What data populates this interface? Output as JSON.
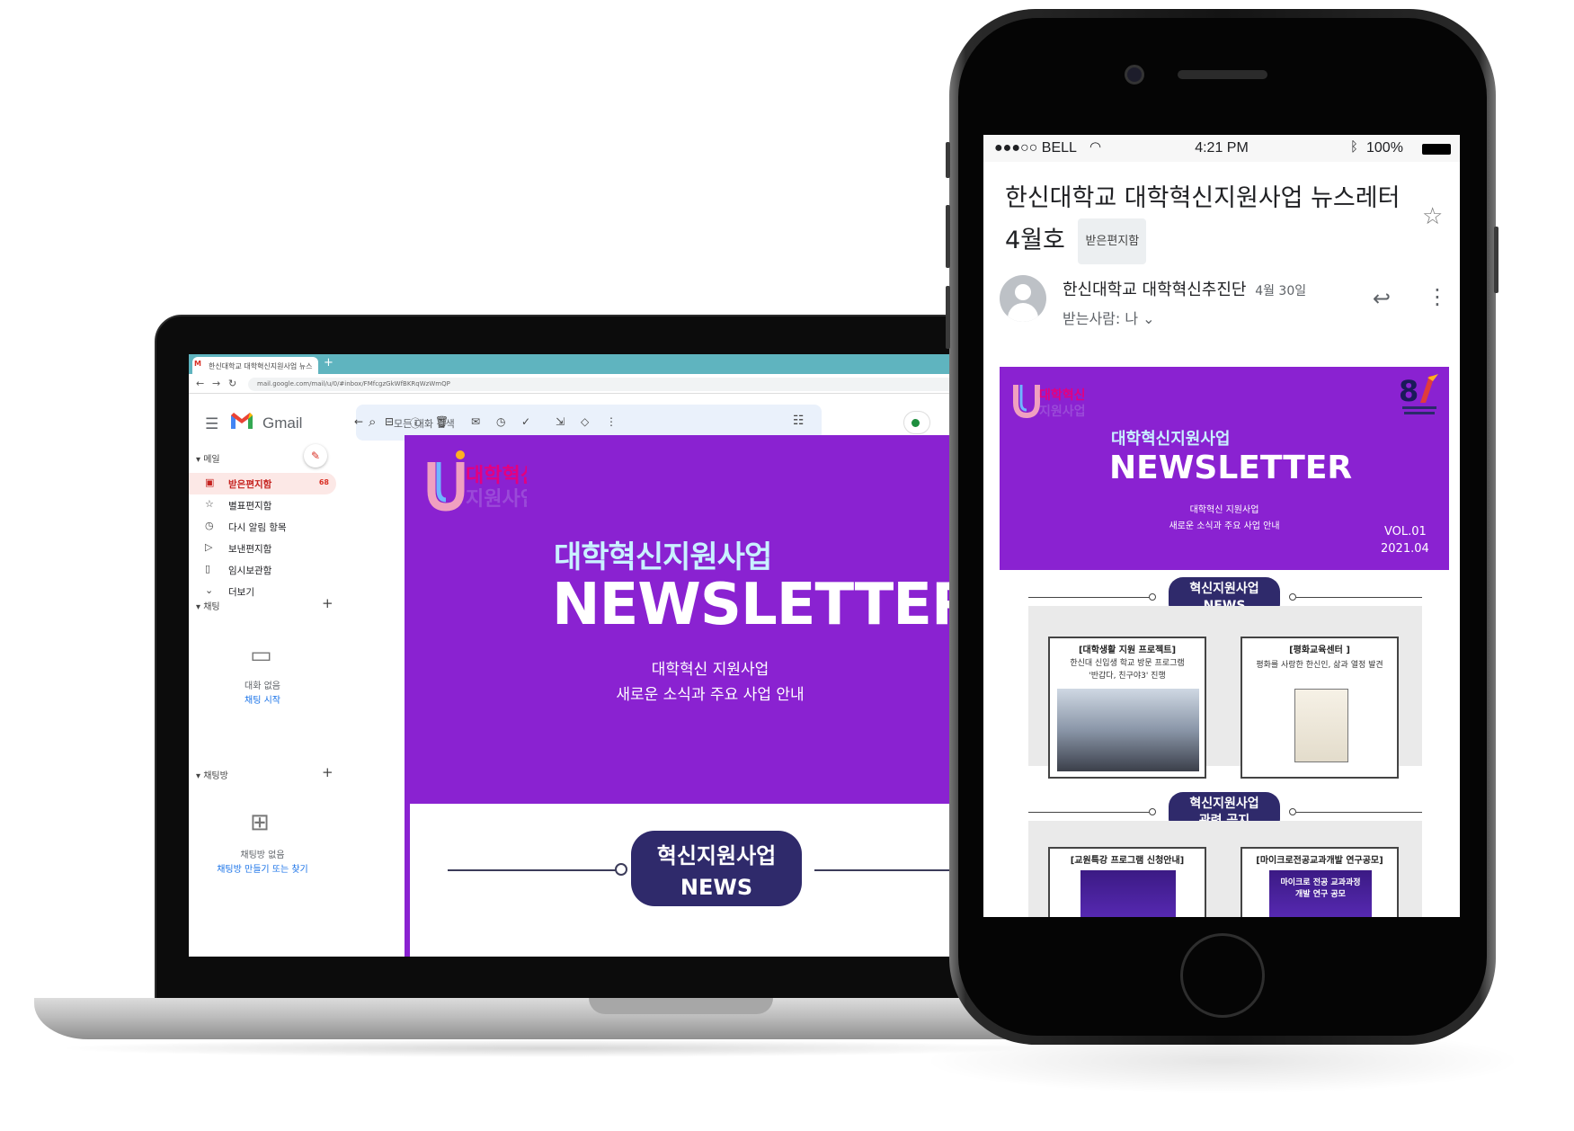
{
  "laptop": {
    "browser": {
      "tab_title": "한신대학교 대학혁신지원사업 뉴스",
      "new_tab": "+",
      "url": "mail.google.com/mail/u/0/#inbox/FMfcgzGkWfBKRqWzWmQP"
    },
    "gmail": {
      "brand": "Gmail",
      "search_placeholder": "모든 대화 검색",
      "sections": {
        "mail": "메일",
        "chat": "채팅",
        "spaces": "채팅방"
      },
      "nav": [
        {
          "icon": "inbox-icon",
          "label": "받은편지함",
          "count": "68"
        },
        {
          "icon": "star-icon",
          "label": "별표편지함",
          "count": ""
        },
        {
          "icon": "clock-icon",
          "label": "다시 알림 항목",
          "count": ""
        },
        {
          "icon": "send-icon",
          "label": "보낸편지함",
          "count": ""
        },
        {
          "icon": "draft-icon",
          "label": "임시보관함",
          "count": ""
        },
        {
          "icon": "chevron-down-icon",
          "label": "더보기",
          "count": ""
        }
      ],
      "chat_empty": {
        "text": "대화 없음",
        "link": "채팅 시작"
      },
      "spaces_empty": {
        "text": "채팅방 없음",
        "link": "채팅방 만들기 또는 찾기"
      }
    },
    "newsletter": {
      "logo_text": "대학혁신\n지원사업",
      "subtitle": "대학혁신지원사업",
      "title": "NEWSLETTER",
      "desc_line1": "대학혁신 지원사업",
      "desc_line2": "새로운 소식과 주요 사업 안내",
      "pill_line1": "혁신지원사업",
      "pill_line2": "NEWS"
    }
  },
  "phone": {
    "status": {
      "carrier": "●●●○○ BELL",
      "time": "4:21 PM",
      "battery": "100%"
    },
    "email": {
      "subject": "한신대학교 대학혁신지원사업 뉴스레터 4월호",
      "label": "받은편지함",
      "sender": "한신대학교 대학혁신추진단",
      "date": "4월 30일",
      "to": "받는사람: 나"
    },
    "newsletter": {
      "logo_text": "대학혁신\n지원사업",
      "subtitle": "대학혁신지원사업",
      "title": "NEWSLETTER",
      "desc_line1": "대학혁신 지원사업",
      "desc_line2": "새로운 소식과 주요 사업 안내",
      "vol": "VOL.01",
      "date": "2021.04",
      "pill1_line1": "혁신지원사업",
      "pill1_line2": "NEWS",
      "pill2_line1": "혁신지원사업",
      "pill2_line2": "관련 공지",
      "cards": [
        {
          "title": "[대학생활 지원 프로젝트]",
          "line1": "한신대 신입생 학교 방문 프로그램",
          "line2": "'반갑다, 친구야3' 진행"
        },
        {
          "title": "[평화교육센터 ]",
          "line1": "평화를 사랑한 한신인, 삶과 열정 발견",
          "line2": ""
        },
        {
          "title": "[교원특강 프로그램 신청안내]",
          "line1": "",
          "line2": ""
        },
        {
          "title": "[마이크로전공교과개발 연구공모]",
          "line1": "마이크로 전공 교과과정",
          "line2": "개발 연구 공모"
        }
      ]
    }
  },
  "colors": {
    "newsletter_purple": "#8a22d1",
    "pill_navy": "#2f2a6b",
    "gmail_red": "#d93025",
    "browser_teal": "#5fb4bf"
  }
}
